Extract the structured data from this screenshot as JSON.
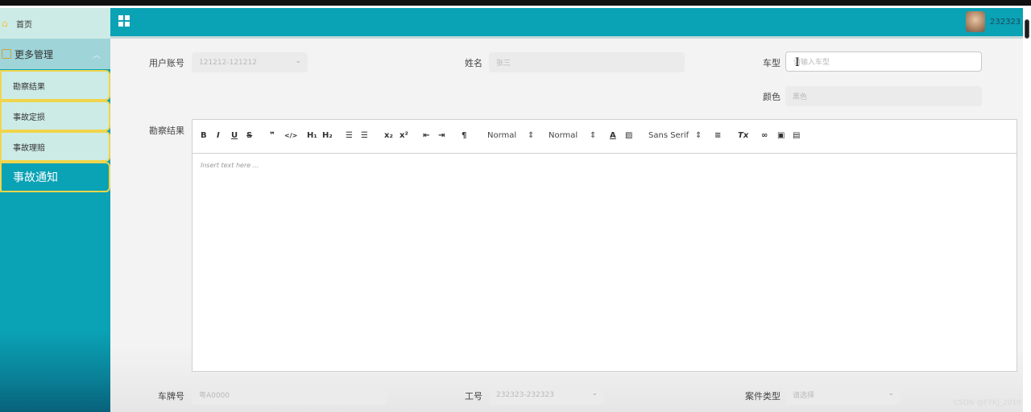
{
  "sidebar": {
    "home_label": "首页",
    "group_label": "更多管理",
    "items": [
      {
        "label": "勘察结果"
      },
      {
        "label": "事故定损"
      },
      {
        "label": "事故理赔"
      },
      {
        "label": "事故通知"
      }
    ]
  },
  "header": {
    "username": "232323"
  },
  "form": {
    "account": {
      "label": "用户账号",
      "value": "121212-121212"
    },
    "name": {
      "label": "姓名",
      "placeholder": "张三"
    },
    "car_type": {
      "label": "车型",
      "placeholder": "请输入车型"
    },
    "color": {
      "label": "颜色",
      "placeholder": "黑色"
    },
    "survey_result": {
      "label": "勘察结果"
    },
    "plate": {
      "label": "车牌号",
      "placeholder": "粤A0000"
    },
    "job_no": {
      "label": "工号",
      "value": "232323-232323"
    },
    "case_type": {
      "label": "案件类型",
      "placeholder": "请选择"
    }
  },
  "editor": {
    "header_select": "Normal",
    "size_select": "Normal",
    "font_select": "Sans Serif",
    "placeholder": "Insert text here ..."
  },
  "watermark": "CSDN @FYKJ_2010",
  "colors": {
    "accent": "#0aa2b5",
    "sidebar_item_bg": "#cdebe6",
    "sidebar_item_border": "#f0d54c"
  }
}
